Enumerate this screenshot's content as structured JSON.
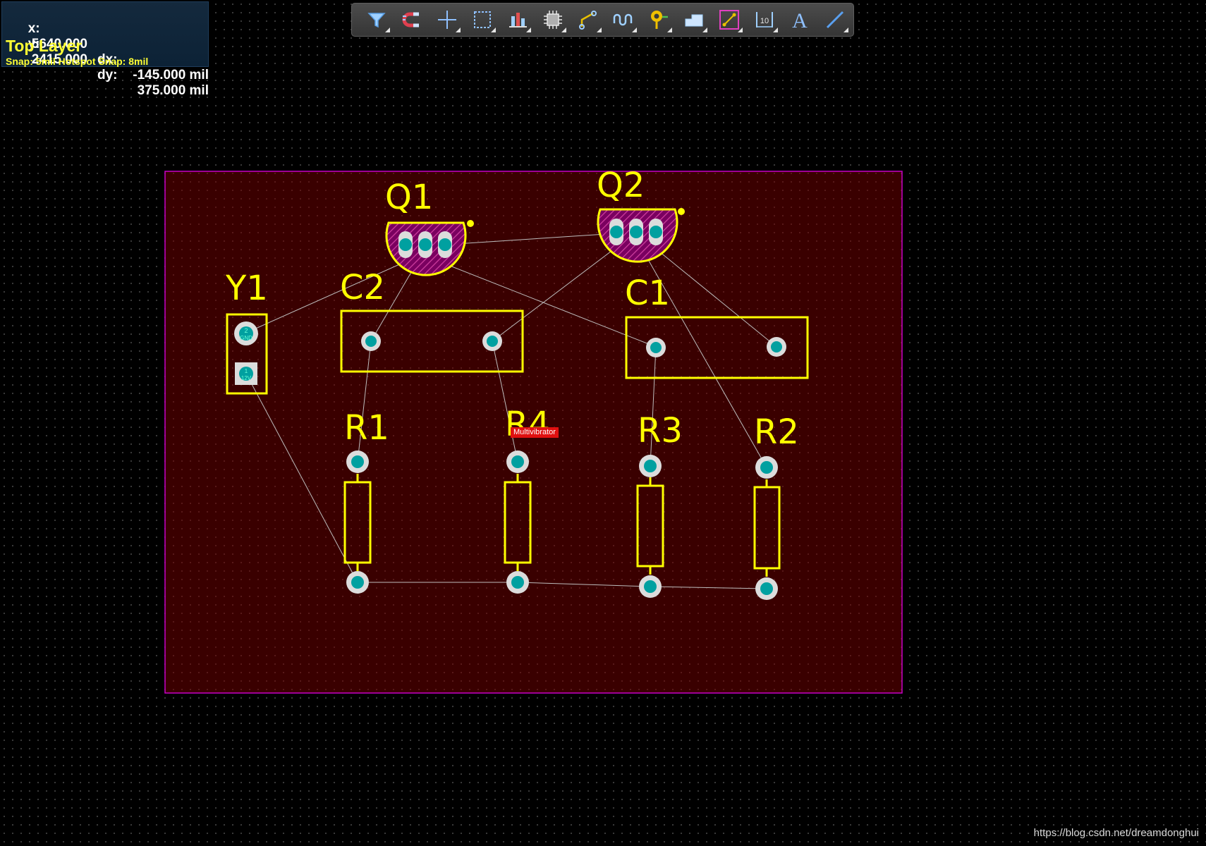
{
  "hud": {
    "x_label": "x:",
    "x_value": "5640.000",
    "dx_label": "dx:",
    "dx_value": "-145.000 mil",
    "y_label": "y:",
    "y_value": "2415.000",
    "dy_label": "dy:",
    "dy_value": "375.000 mil",
    "layer": "Top Layer",
    "snap": "Snap: 5mil Hotspot Snap: 8mil"
  },
  "toolbar": {
    "tools": [
      {
        "name": "filter-icon"
      },
      {
        "name": "snap-magnet-icon"
      },
      {
        "name": "crosshair-icon"
      },
      {
        "name": "select-rectangle-icon"
      },
      {
        "name": "align-icon"
      },
      {
        "name": "component-icon"
      },
      {
        "name": "route-track-icon"
      },
      {
        "name": "interactive-tuning-icon"
      },
      {
        "name": "via-pad-icon"
      },
      {
        "name": "polygon-pour-icon"
      },
      {
        "name": "routing-line-icon"
      },
      {
        "name": "dimension-icon"
      },
      {
        "name": "text-string-icon"
      },
      {
        "name": "line-icon"
      }
    ]
  },
  "pcb": {
    "board_color": "#3a0000",
    "outline_color": "#c800c8",
    "silkscreen_color": "#ffff00",
    "pad_color": "#00a0a0",
    "ratsnest_color": "#bfbfbf",
    "components": {
      "Q1": "Q1",
      "Q2": "Q2",
      "Y1": "Y1",
      "C1": "C1",
      "C2": "C2",
      "R1": "R1",
      "R2": "R2",
      "R3": "R3",
      "R4": "R4"
    },
    "pad_labels": {
      "y1_pad2": "2",
      "y1_pad2_net": "GND",
      "y1_pad1": "1",
      "y1_pad1_net": "12V"
    },
    "net_tag": "Multivibrator"
  },
  "watermark": "https://blog.csdn.net/dreamdonghui"
}
